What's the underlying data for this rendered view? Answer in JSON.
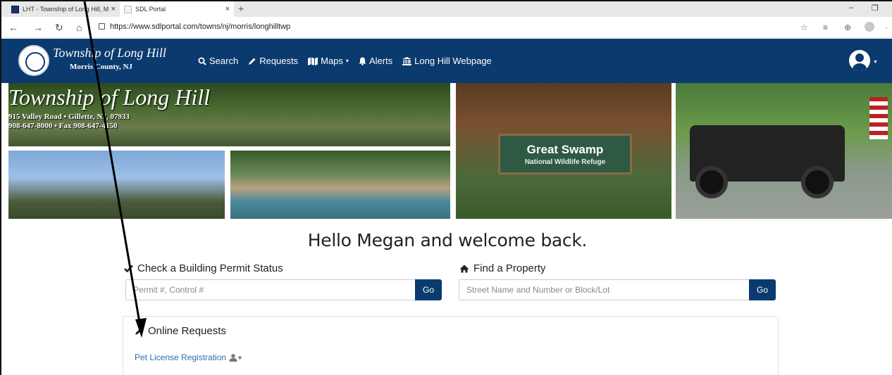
{
  "browser": {
    "tabs": [
      {
        "label": "LHT - Township of Long Hill, Mor",
        "active": false
      },
      {
        "label": "SDL Portal",
        "active": true
      }
    ],
    "new_tab": "+",
    "close": "×",
    "url": "https://www.sdlportal.com/towns/nj/morris/longhilltwp",
    "nav": {
      "back": "←",
      "forward": "→",
      "refresh": "↻",
      "home": "⌂"
    },
    "window_controls": {
      "minimize": "–",
      "maximize": "❐"
    }
  },
  "site": {
    "brand_title": "Township of Long Hill",
    "brand_subtitle": "Morris County, NJ",
    "nav": [
      {
        "icon": "search-icon",
        "label": "Search"
      },
      {
        "icon": "pencil-icon",
        "label": "Requests"
      },
      {
        "icon": "map-icon",
        "label": "Maps"
      },
      {
        "icon": "bell-icon",
        "label": "Alerts"
      },
      {
        "icon": "building-icon",
        "label": "Long Hill Webpage"
      }
    ]
  },
  "banner": {
    "title": "Township of Long Hill",
    "address_line1": "915 Valley Road • Gillette, NJ, 07933",
    "address_line2": "908-647-8000 • Fax 908-647-4150",
    "sign_line1": "Great Swamp",
    "sign_line2": "National Wildlife Refuge"
  },
  "main": {
    "welcome": "Hello Megan and welcome back.",
    "permit": {
      "label": "Check a Building Permit Status",
      "placeholder": "Permit #, Control #",
      "go": "Go"
    },
    "property": {
      "label": "Find a Property",
      "placeholder": "Street Name and Number or Block/Lot",
      "go": "Go"
    },
    "online_requests": {
      "title": "Online Requests",
      "link": "Pet License Registration"
    }
  },
  "colors": {
    "navy": "#0b3a6f",
    "link": "#2b6cb0"
  }
}
